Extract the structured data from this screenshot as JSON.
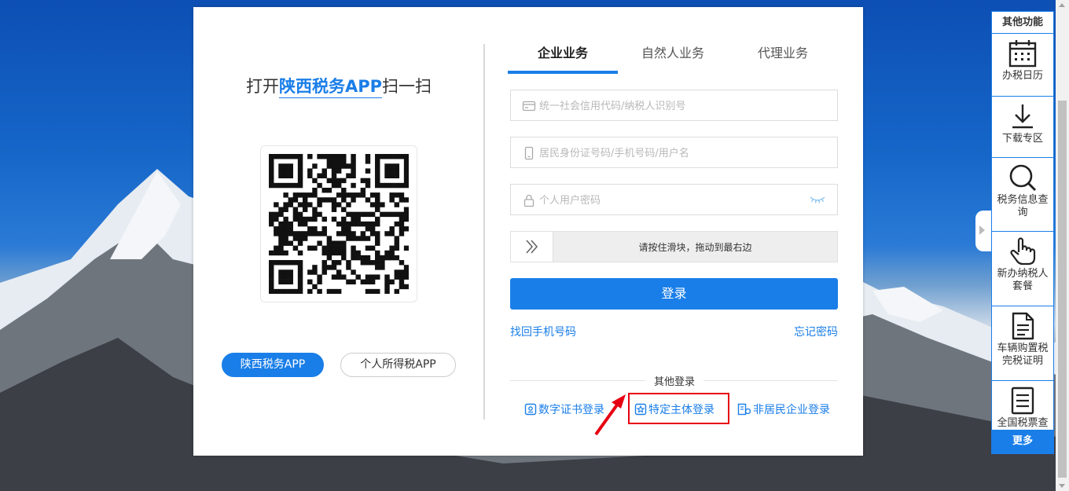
{
  "colors": {
    "accent": "#1a7ee8",
    "highlight": "#e60012"
  },
  "qr": {
    "title_prefix": "打开",
    "title_app": "陕西税务APP",
    "title_suffix": "扫一扫",
    "app_buttons": [
      "陕西税务APP",
      "个人所得税APP"
    ]
  },
  "tabs": [
    {
      "label": "企业业务",
      "active": true
    },
    {
      "label": "自然人业务",
      "active": false
    },
    {
      "label": "代理业务",
      "active": false
    }
  ],
  "form": {
    "credit_code_placeholder": "统一社会信用代码/纳税人识别号",
    "id_placeholder": "居民身份证号码/手机号码/用户名",
    "password_placeholder": "个人用户密码",
    "slider_text": "请按住滑块，拖动到最右边",
    "login_label": "登录",
    "find_phone": "找回手机号码",
    "forgot_password": "忘记密码"
  },
  "other_login": {
    "label": "其他登录",
    "options": [
      {
        "label": "数字证书登录",
        "icon": "certificate-icon"
      },
      {
        "label": "特定主体登录",
        "icon": "star-badge-icon"
      },
      {
        "label": "非居民企业登录",
        "icon": "nonresident-icon"
      }
    ]
  },
  "side_toolbar": {
    "title": "其他功能",
    "items": [
      {
        "label": "办税日历",
        "icon": "calendar-icon"
      },
      {
        "label": "下载专区",
        "icon": "download-icon"
      },
      {
        "label": "税务信息查询",
        "icon": "search-icon"
      },
      {
        "label": "新办纳税人套餐",
        "icon": "hand-pointer-icon"
      },
      {
        "label": "车辆购置税完税证明",
        "icon": "document-icon"
      },
      {
        "label": "全国税票查验",
        "icon": "invoice-icon"
      }
    ],
    "more": "更多"
  }
}
